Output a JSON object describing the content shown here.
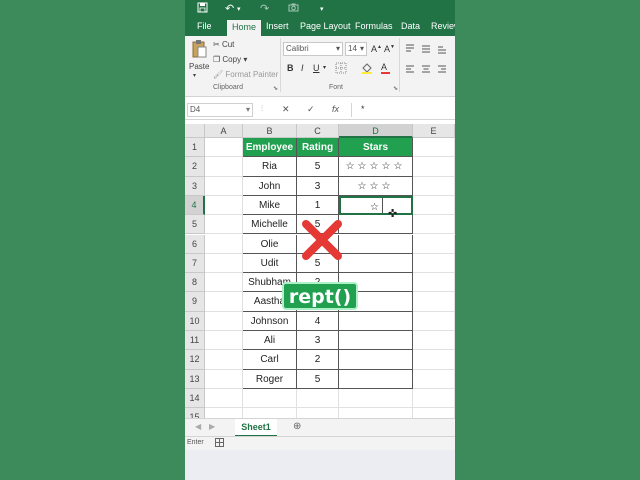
{
  "qat": {
    "save_icon": "save-icon",
    "undo_icon": "undo-icon",
    "redo_icon": "redo-icon",
    "camera_icon": "camera-icon",
    "customize_icon": "chevron-down-icon"
  },
  "tabs": [
    "File",
    "Home",
    "Insert",
    "Page Layout",
    "Formulas",
    "Data",
    "Review"
  ],
  "active_tab": "Home",
  "ribbon": {
    "paste_label": "Paste",
    "cut_label": "Cut",
    "copy_label": "Copy",
    "format_painter_label": "Format Painter",
    "clipboard_label": "Clipboard",
    "font_name": "Calibri",
    "font_size": "14",
    "font_label": "Font",
    "bold": "B",
    "italic": "I",
    "underline": "U"
  },
  "formula_bar": {
    "name_box": "D4",
    "cancel": "✕",
    "enter": "✓",
    "fx": "fx",
    "content": "*"
  },
  "columns": [
    "A",
    "B",
    "C",
    "D",
    "E"
  ],
  "rows": [
    "1",
    "2",
    "3",
    "4",
    "5",
    "6",
    "7",
    "8",
    "9",
    "10",
    "11",
    "12",
    "13",
    "14",
    "15"
  ],
  "table": {
    "headers": [
      "Employee",
      "Rating",
      "Stars"
    ],
    "rows": [
      {
        "name": "Ria",
        "rating": "5",
        "stars": "☆☆☆☆☆"
      },
      {
        "name": "John",
        "rating": "3",
        "stars": "☆☆☆"
      },
      {
        "name": "Mike",
        "rating": "1",
        "stars": "☆"
      },
      {
        "name": "Michelle",
        "rating": "5",
        "stars": ""
      },
      {
        "name": "Olie",
        "rating": "",
        "stars": ""
      },
      {
        "name": "Udit",
        "rating": "5",
        "stars": ""
      },
      {
        "name": "Shubham",
        "rating": "2",
        "stars": ""
      },
      {
        "name": "Aastha",
        "rating": "",
        "stars": ""
      },
      {
        "name": "Johnson",
        "rating": "4",
        "stars": ""
      },
      {
        "name": "Ali",
        "rating": "3",
        "stars": ""
      },
      {
        "name": "Carl",
        "rating": "2",
        "stars": ""
      },
      {
        "name": "Roger",
        "rating": "5",
        "stars": ""
      }
    ]
  },
  "sheet_tab": "Sheet1",
  "status": "Enter",
  "overlay": {
    "label": "rept()"
  },
  "colors": {
    "excel_green": "#217346",
    "header_green": "#21a150",
    "cross_red": "#e53935",
    "background": "#3d8a5a"
  }
}
